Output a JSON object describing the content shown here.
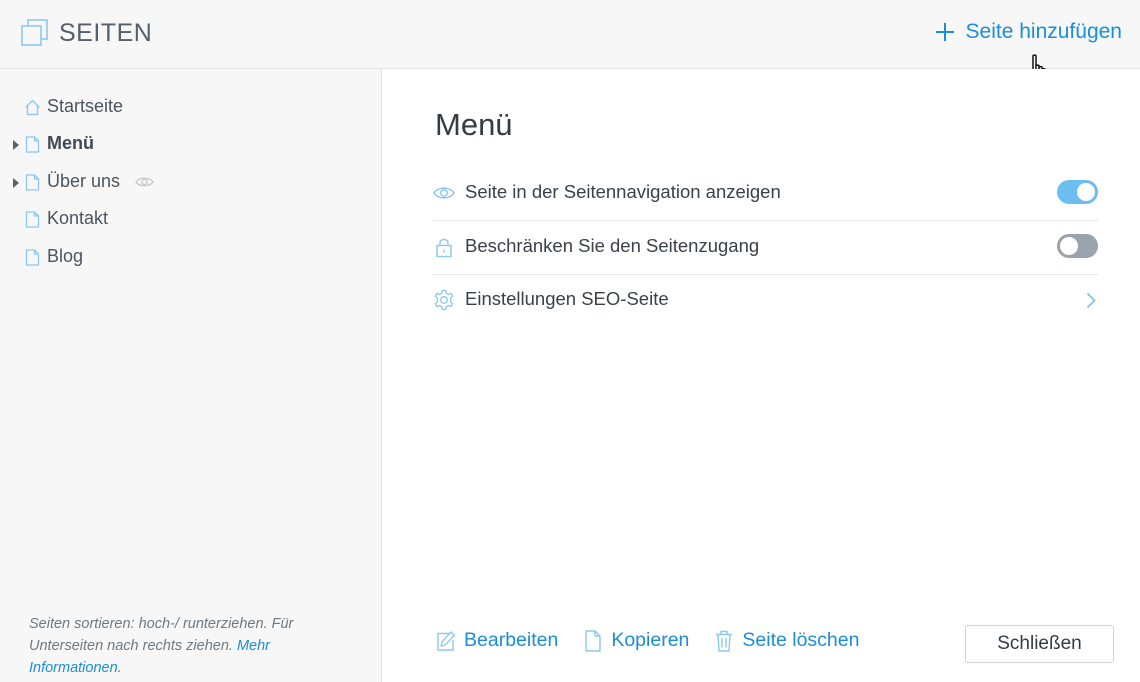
{
  "header": {
    "title": "SEITEN",
    "add_page_label": "Seite hinzufügen"
  },
  "sidebar": {
    "items": [
      {
        "label": "Startseite",
        "icon": "home-icon",
        "has_children": false,
        "active": false,
        "hidden": false
      },
      {
        "label": "Menü",
        "icon": "page-icon",
        "has_children": true,
        "active": true,
        "hidden": false
      },
      {
        "label": "Über uns",
        "icon": "page-icon",
        "has_children": true,
        "active": false,
        "hidden": true
      },
      {
        "label": "Kontakt",
        "icon": "page-icon",
        "has_children": false,
        "active": false,
        "hidden": false
      },
      {
        "label": "Blog",
        "icon": "page-icon",
        "has_children": false,
        "active": false,
        "hidden": false
      }
    ],
    "hint_text": "Seiten sortieren: hoch-/ runterziehen. Für Unterseiten nach rechts ziehen.",
    "hint_link": "Mehr Informationen",
    "hint_suffix": "."
  },
  "main": {
    "page_title": "Menü",
    "settings": [
      {
        "label": "Seite in der Seitennavigation anzeigen",
        "icon": "eye-icon",
        "control": "toggle",
        "value": true
      },
      {
        "label": "Beschränken Sie den Seitenzugang",
        "icon": "lock-icon",
        "control": "toggle",
        "value": false
      },
      {
        "label": "Einstellungen SEO-Seite",
        "icon": "gear-icon",
        "control": "chevron"
      }
    ],
    "actions": {
      "edit": "Bearbeiten",
      "copy": "Kopieren",
      "delete": "Seite löschen"
    },
    "close_label": "Schließen"
  },
  "colors": {
    "accent": "#1a8ed8",
    "toggle_on": "#6cbef0",
    "toggle_off": "#9aa3ab",
    "sidebar_bg": "#f7f7f7"
  }
}
